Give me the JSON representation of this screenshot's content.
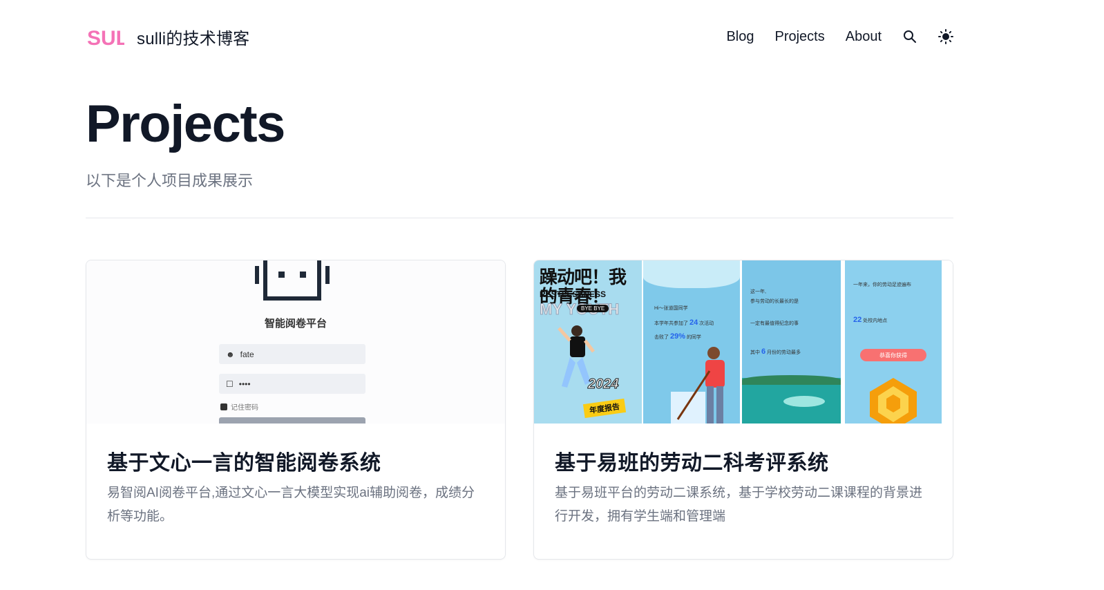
{
  "header": {
    "brand_name": "sulli的技术博客",
    "logo_text": "SULLI",
    "nav": [
      {
        "label": "Blog"
      },
      {
        "label": "Projects"
      },
      {
        "label": "About"
      }
    ],
    "icons": [
      "search-icon",
      "sun-icon"
    ]
  },
  "hero": {
    "title": "Projects",
    "description": "以下是个人项目成果展示"
  },
  "projects": [
    {
      "title": "基于文心一言的智能阅卷系统",
      "description": "易智阅AI阅卷平台,通过文心一言大模型实现ai辅助阅卷，成绩分析等功能。",
      "image": {
        "platform_name": "智能阅卷平台",
        "username": "fate",
        "password_mask": "••••",
        "remember_label": "记住密码"
      }
    },
    {
      "title": "基于易班的劳动二科考评系统",
      "description": "基于易班平台的劳动二课系统，基于学校劳动二课课程的背景进行开发，拥有学生端和管理端",
      "image": {
        "poster_title": "躁动吧！我的青春！",
        "poster_en": "RESTLESSNESS",
        "poster_en2": "MY YOUTH",
        "poster_badge": "BYE BYE",
        "poster_year": "2024",
        "poster_report": "年度报告",
        "s2_greeting": "Hi～张道国同学",
        "s2_line1_a": "本学年共参加了",
        "s2_line1_num": "24",
        "s2_line1_b": "次活动",
        "s2_line2_a": "击败了",
        "s2_line2_num": "29%",
        "s2_line2_b": "的同学",
        "s3_line1": "这一年,",
        "s3_line2": "参与劳动的长最长的是",
        "s3_line3": "一定有最值得纪念的事",
        "s3_line4_a": "其中",
        "s3_line4_num": "6",
        "s3_line4_b": "月份的劳动最多",
        "s4_line1": "一年来，你的劳动足迹遍布",
        "s4_line2_num": "22",
        "s4_line2_b": "处校内地点",
        "s4_button": "恭喜你获得"
      }
    }
  ],
  "colors": {
    "text": "#111827",
    "muted": "#6b7280",
    "border": "#e5e7eb"
  }
}
